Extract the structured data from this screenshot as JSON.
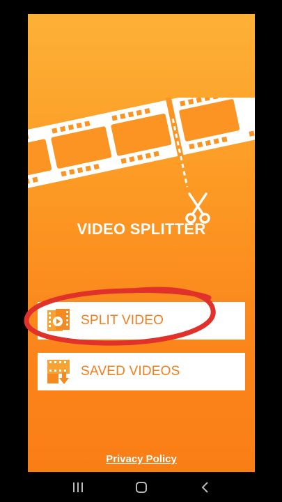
{
  "app": {
    "title": "VIDEO SPLITTER"
  },
  "menu": {
    "split_video_label": "SPLIT VIDEO",
    "saved_videos_label": "SAVED VIDEOS"
  },
  "footer": {
    "privacy_label": "Privacy Policy"
  },
  "icons": {
    "banner": "film-strip-scissors-icon",
    "split": "film-play-icon",
    "saved": "film-download-icon",
    "nav_recents": "recents-icon",
    "nav_home": "home-icon",
    "nav_back": "back-icon"
  },
  "colors": {
    "gradient_top": "#FDB137",
    "gradient_bottom": "#FA7E16",
    "accent": "#F47D1B",
    "annotation": "#E0312A"
  }
}
